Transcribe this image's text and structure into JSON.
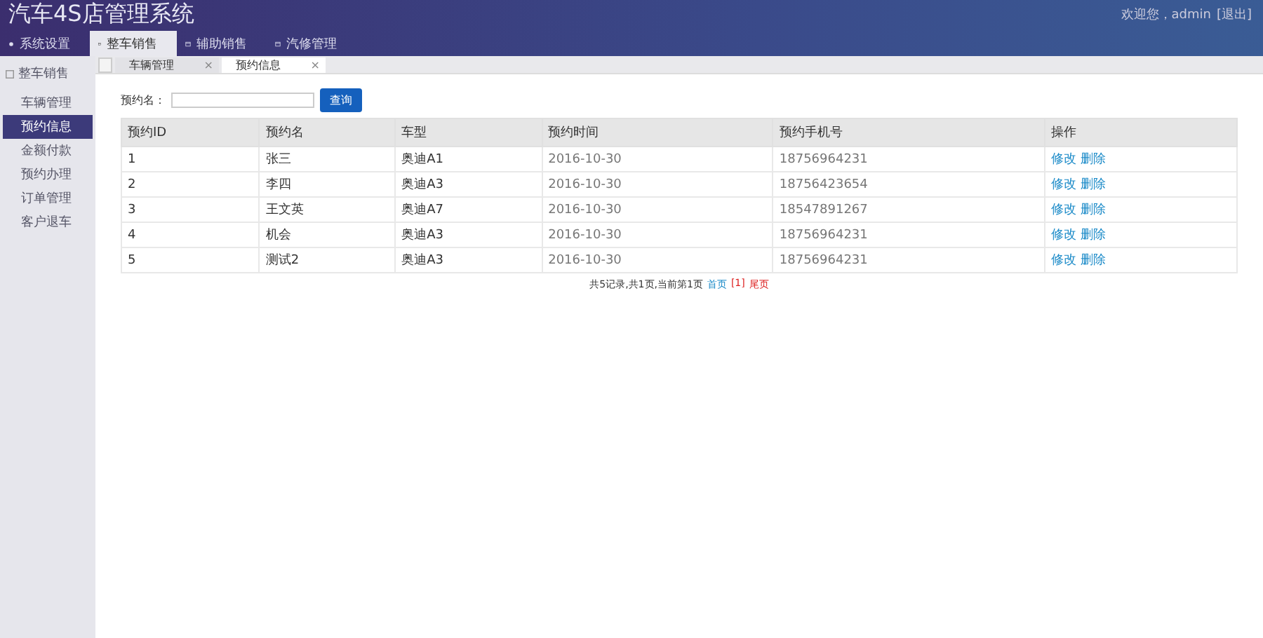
{
  "header": {
    "title": "汽车4S店管理系统",
    "welcome": "欢迎您，admin",
    "logout": "[退出]"
  },
  "main_tabs": [
    {
      "label": "系统设置",
      "selected": false
    },
    {
      "label": "整车销售",
      "selected": true
    },
    {
      "label": "辅助销售",
      "selected": false
    },
    {
      "label": "汽修管理",
      "selected": false
    }
  ],
  "sidebar": {
    "title": "整车销售",
    "items": [
      {
        "label": "车辆管理",
        "selected": false
      },
      {
        "label": "预约信息",
        "selected": true
      },
      {
        "label": "金额付款",
        "selected": false
      },
      {
        "label": "预约办理",
        "selected": false
      },
      {
        "label": "订单管理",
        "selected": false
      },
      {
        "label": "客户退车",
        "selected": false
      }
    ]
  },
  "page_tabs": [
    {
      "label": "车辆管理",
      "selected": false,
      "close": "×"
    },
    {
      "label": "预约信息",
      "selected": true,
      "close": "×"
    }
  ],
  "search": {
    "label": "预约名：",
    "button": "查询"
  },
  "table": {
    "columns": [
      "预约ID",
      "预约名",
      "车型",
      "预约时间",
      "预约手机号",
      "操作"
    ],
    "rows": [
      {
        "cells": [
          "1",
          "张三",
          "奥迪A1",
          "2016-10-30",
          "18756964231"
        ],
        "actions": [
          "修改",
          "删除"
        ]
      },
      {
        "cells": [
          "2",
          "李四",
          "奥迪A3",
          "2016-10-30",
          "18756423654"
        ],
        "actions": [
          "修改",
          "删除"
        ]
      },
      {
        "cells": [
          "3",
          "王文英",
          "奥迪A7",
          "2016-10-30",
          "18547891267"
        ],
        "actions": [
          "修改",
          "删除"
        ]
      },
      {
        "cells": [
          "4",
          "机会",
          "奥迪A3",
          "2016-10-30",
          "18756964231"
        ],
        "actions": [
          "修改",
          "删除"
        ]
      },
      {
        "cells": [
          "5",
          "测试2",
          "奥迪A3",
          "2016-10-30",
          "18756964231"
        ],
        "actions": [
          "修改",
          "删除"
        ]
      }
    ]
  },
  "pagination": {
    "summary": "共5记录,共1页,当前第1页",
    "first": "首页",
    "current": "[1]",
    "last": "尾页"
  }
}
